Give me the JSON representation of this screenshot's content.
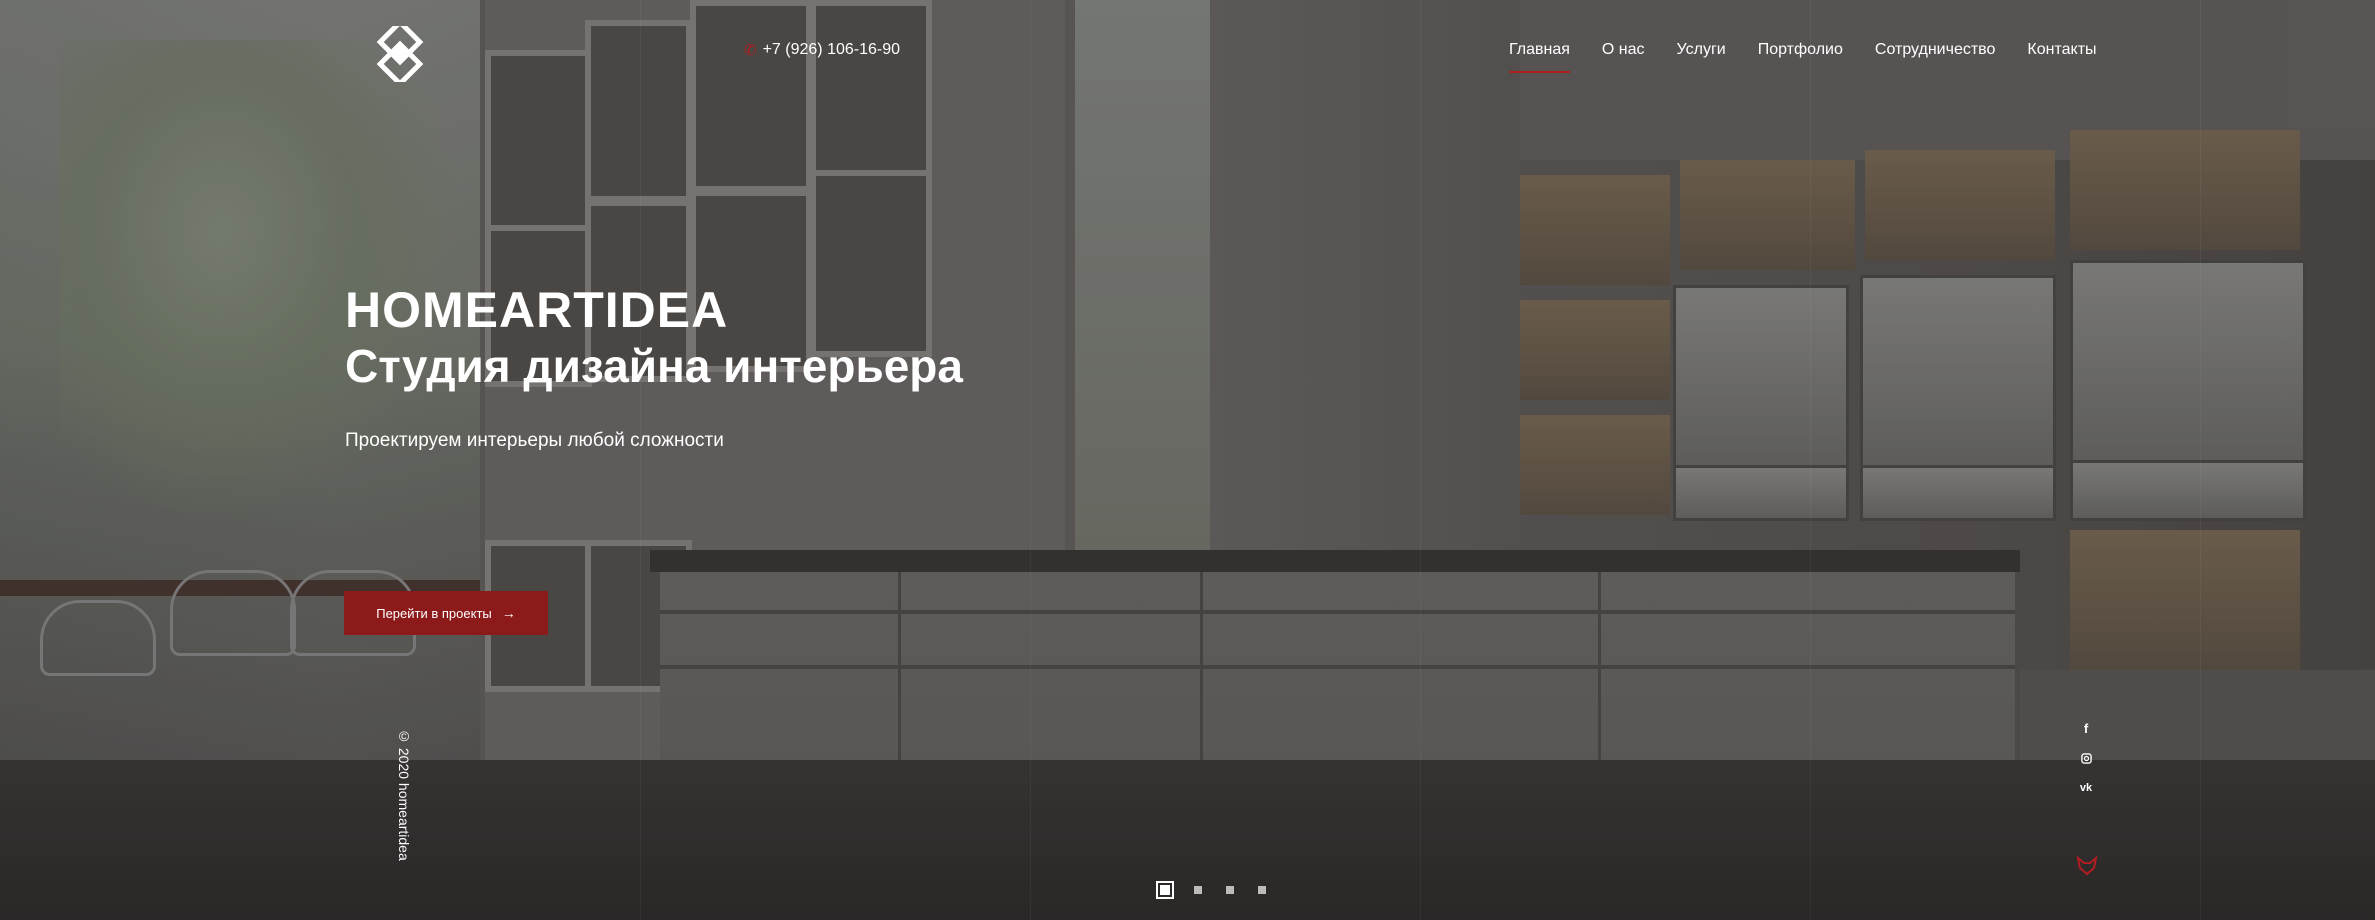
{
  "header": {
    "phone": "+7 (926) 106-16-90",
    "nav": [
      {
        "label": "Главная",
        "active": true
      },
      {
        "label": "О нас",
        "active": false
      },
      {
        "label": "Услуги",
        "active": false
      },
      {
        "label": "Портфолио",
        "active": false
      },
      {
        "label": "Сотрудничество",
        "active": false
      },
      {
        "label": "Контакты",
        "active": false
      }
    ]
  },
  "hero": {
    "brand": "HOMEARTIDEA",
    "title": "Студия дизайна интерьера",
    "subtitle": "Проектируем интерьеры любой сложности",
    "cta_label": "Перейти в проекты"
  },
  "footer": {
    "copyright": "© 2020 homeartidea"
  },
  "socials": [
    "facebook-icon",
    "instagram-icon",
    "vk-icon"
  ],
  "slider": {
    "count": 4,
    "active_index": 0
  },
  "colors": {
    "accent": "#8c1a1a",
    "accent_line": "#b01c20",
    "text": "#ffffff"
  }
}
